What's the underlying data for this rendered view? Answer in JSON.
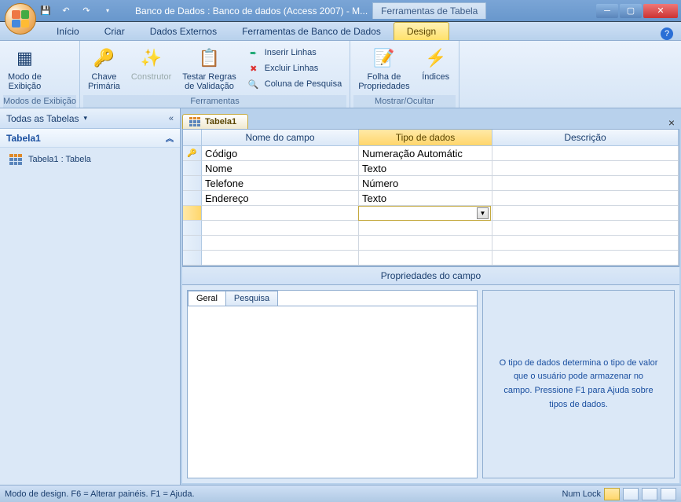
{
  "title": "Banco de Dados : Banco de dados (Access 2007) - M...",
  "tool_tab_title": "Ferramentas de Tabela",
  "tabs": {
    "inicio": "Início",
    "criar": "Criar",
    "dados_externos": "Dados Externos",
    "ferramentas_bd": "Ferramentas de Banco de Dados",
    "design": "Design"
  },
  "ribbon": {
    "modos_exibicao": {
      "label": "Modos de Exibição",
      "modo_de_exibicao": "Modo de\nExibição"
    },
    "ferramentas": {
      "label": "Ferramentas",
      "chave_primaria": "Chave\nPrimária",
      "construtor": "Construtor",
      "testar_regras": "Testar Regras\nde Validação",
      "inserir_linhas": "Inserir Linhas",
      "excluir_linhas": "Excluir Linhas",
      "coluna_pesquisa": "Coluna de Pesquisa"
    },
    "mostrar_ocultar": {
      "label": "Mostrar/Ocultar",
      "folha_propriedades": "Folha de\nPropriedades",
      "indices": "Índices"
    }
  },
  "navpane": {
    "header": "Todas as Tabelas",
    "group": "Tabela1",
    "item": "Tabela1 : Tabela"
  },
  "doc": {
    "tab": "Tabela1"
  },
  "grid": {
    "cols": {
      "nome": "Nome do campo",
      "tipo": "Tipo de dados",
      "desc": "Descrição"
    },
    "rows": [
      {
        "key": true,
        "nome": "Código",
        "tipo": "Numeração Automátic",
        "desc": ""
      },
      {
        "key": false,
        "nome": "Nome",
        "tipo": "Texto",
        "desc": ""
      },
      {
        "key": false,
        "nome": "Telefone",
        "tipo": "Número",
        "desc": ""
      },
      {
        "key": false,
        "nome": "Endereço",
        "tipo": "Texto",
        "desc": ""
      }
    ]
  },
  "field_props": {
    "header": "Propriedades do campo",
    "tab_geral": "Geral",
    "tab_pesquisa": "Pesquisa",
    "help": "O tipo de dados determina o tipo de valor que o usuário pode armazenar no campo. Pressione F1 para Ajuda sobre tipos de dados."
  },
  "statusbar": {
    "left": "Modo de design. F6 = Alterar painéis. F1 = Ajuda.",
    "numlock": "Num Lock"
  }
}
